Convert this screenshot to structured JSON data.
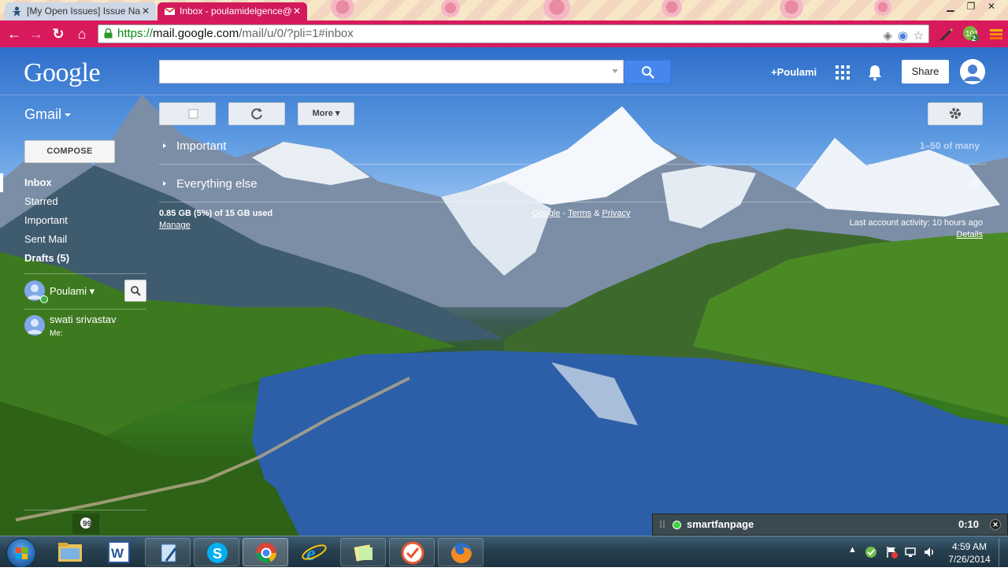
{
  "browser": {
    "tabs": [
      {
        "title": "[My Open Issues] Issue Na",
        "active": false
      },
      {
        "title": "Inbox - poulamidelgence@",
        "active": true
      }
    ],
    "url": {
      "scheme": "https://",
      "host": "mail.google.com",
      "path": "/mail/u/0/?pli=1#inbox"
    },
    "accent_color": "#d81a5d",
    "extension_badge": "2"
  },
  "header": {
    "logo": "Google",
    "search_value": "",
    "user_link": "+Poulami",
    "share_label": "Share"
  },
  "toolbar": {
    "app_label": "Gmail",
    "more_label": "More"
  },
  "sidebar": {
    "compose_label": "COMPOSE",
    "items": [
      {
        "label": "Inbox",
        "selected": true
      },
      {
        "label": "Starred"
      },
      {
        "label": "Important"
      },
      {
        "label": "Sent Mail"
      },
      {
        "label": "Drafts (5)",
        "bold": true
      }
    ]
  },
  "chat": {
    "self_name": "Poulami",
    "contacts": [
      {
        "name": "swati srivastav",
        "status": "Me: "
      }
    ]
  },
  "inbox": {
    "sections": [
      {
        "label": "Important",
        "right": ""
      },
      {
        "label": "Everything else",
        "right": ""
      }
    ],
    "pagination": "1–50 of many",
    "storage": "0.85 GB (5%) of 15 GB used",
    "manage": "Manage",
    "terms": "Terms",
    "privacy": "Privacy",
    "terms_prefix": "Google",
    "last_activity": "Last account activity: 10 hours ago",
    "details": "Details",
    "more_count": "25"
  },
  "notification": {
    "name": "smartfanpage",
    "timer": "0:10"
  },
  "taskbar": {
    "time": "4:59 AM",
    "date": "7/26/2014"
  }
}
